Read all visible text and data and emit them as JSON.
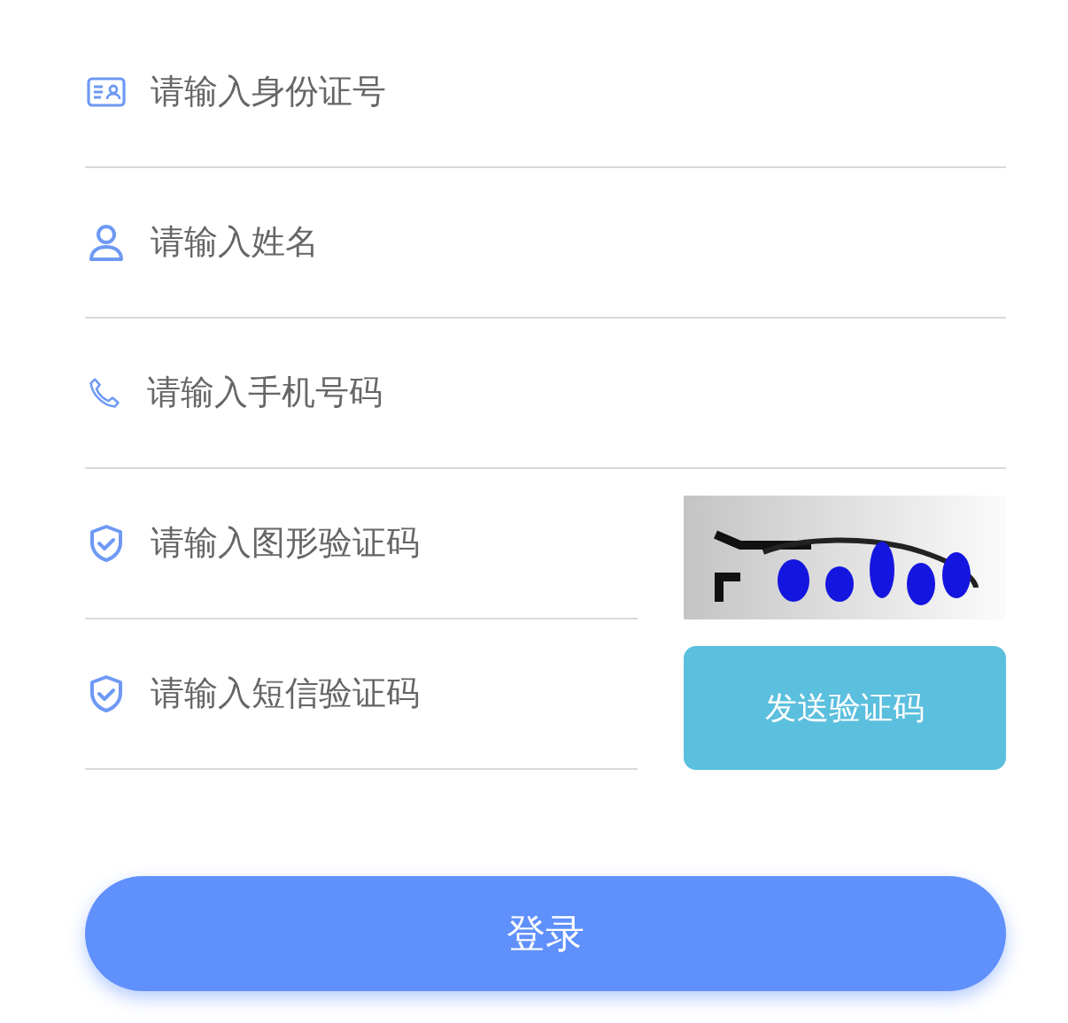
{
  "fields": [
    {
      "kind": "id",
      "placeholder": "请输入身份证号"
    },
    {
      "kind": "name",
      "placeholder": "请输入姓名"
    },
    {
      "kind": "phone",
      "placeholder": "请输入手机号码"
    },
    {
      "kind": "captcha",
      "placeholder": "请输入图形验证码"
    },
    {
      "kind": "sms",
      "placeholder": "请输入短信验证码",
      "button": "发送验证码"
    }
  ],
  "login_button": "登录"
}
